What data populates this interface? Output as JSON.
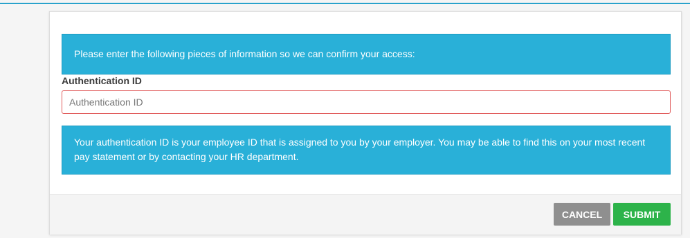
{
  "form": {
    "intro_text": "Please enter the following pieces of information so we can confirm your access:",
    "field_label": "Authentication ID",
    "field_placeholder": "Authentication ID",
    "field_value": "",
    "help_text": "Your authentication ID is your employee ID that is assigned to you by your employer. You may be able to find this on your most recent pay statement or by contacting your HR department."
  },
  "actions": {
    "cancel_label": "CANCEL",
    "submit_label": "SUBMIT"
  },
  "colors": {
    "info_background": "#29b0d8",
    "input_error_border": "#e05b5b",
    "cancel_button": "#8f8f8f",
    "submit_button": "#2db34a"
  }
}
